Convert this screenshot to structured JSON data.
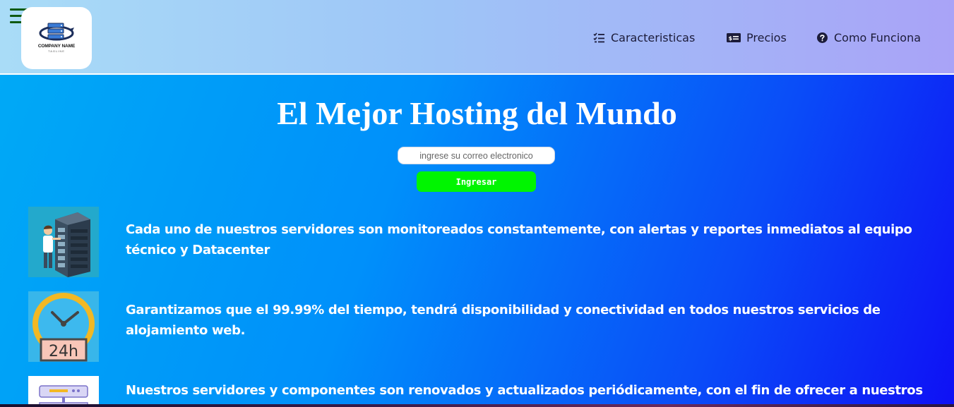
{
  "header": {
    "menu_icon": "hamburger-menu-icon",
    "logo": {
      "name": "COMPANY NAME",
      "tagline": "TAGLINE",
      "icon": "server-stack-logo-icon"
    },
    "nav": [
      {
        "label": "Caracteristicas",
        "icon": "checklist-icon"
      },
      {
        "label": "Precios",
        "icon": "price-tag-icon"
      },
      {
        "label": "Como Funciona",
        "icon": "question-circle-icon"
      }
    ]
  },
  "hero": {
    "title": "El Mejor Hosting del Mundo",
    "email_placeholder": "ingrese su correo electronico",
    "submit_label": "Ingresar"
  },
  "features": [
    {
      "icon": "datacenter-technician-image",
      "text": "Cada uno de nuestros servidores son monitoreados constantemente, con alertas y reportes inmediatos al equipo técnico y Datacenter"
    },
    {
      "icon": "clock-24h-image",
      "text": "Garantizamos que el 99.99% del tiempo, tendrá disponibilidad y conectividad en todos nuestros servicios de alojamiento web."
    },
    {
      "icon": "server-rack-image",
      "text": "Nuestros servidores y componentes son renovados y actualizados periódicamente, con el fin de ofrecer a nuestros"
    }
  ],
  "colors": {
    "header_gradient_start": "#a9dcf7",
    "header_gradient_end": "#a9a3f7",
    "hero_gradient_start": "#00a9f6",
    "hero_gradient_end": "#0f10f5",
    "button": "#00f500",
    "hamburger": "#0f5a12"
  }
}
